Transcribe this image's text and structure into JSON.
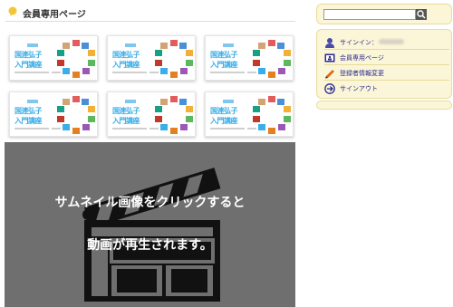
{
  "header": {
    "title": "会員専用ページ",
    "icon": "speech-bubble-icon"
  },
  "thumbnails": [
    {
      "line1": "国連弘子",
      "line2": "入門講座"
    },
    {
      "line1": "国連弘子",
      "line2": "入門講座"
    },
    {
      "line1": "国連弘子",
      "line2": "入門講座"
    },
    {
      "line1": "国連弘子",
      "line2": "入門講座"
    },
    {
      "line1": "国連弘子",
      "line2": "入門講座"
    },
    {
      "line1": "国連弘子",
      "line2": "入門講座"
    }
  ],
  "video": {
    "line1": "サムネイル画像をクリックすると",
    "line2": "動画が再生されます。",
    "icon": "clapperboard-icon"
  },
  "sidebar": {
    "search": {
      "placeholder": "",
      "button_icon": "search-icon"
    },
    "menu": [
      {
        "label": "サインイン：",
        "icon": "user-icon"
      },
      {
        "label": "会員専用ページ",
        "icon": "member-page-icon"
      },
      {
        "label": "登録者情報変更",
        "icon": "pencil-icon"
      },
      {
        "label": "サインアウト",
        "icon": "signout-icon"
      }
    ]
  },
  "colors": {
    "accent_yellow": "#fbf6d8",
    "thumb_blue": "#3aaee8",
    "video_bg": "#6f6f6f",
    "link": "#2b2b8f"
  }
}
